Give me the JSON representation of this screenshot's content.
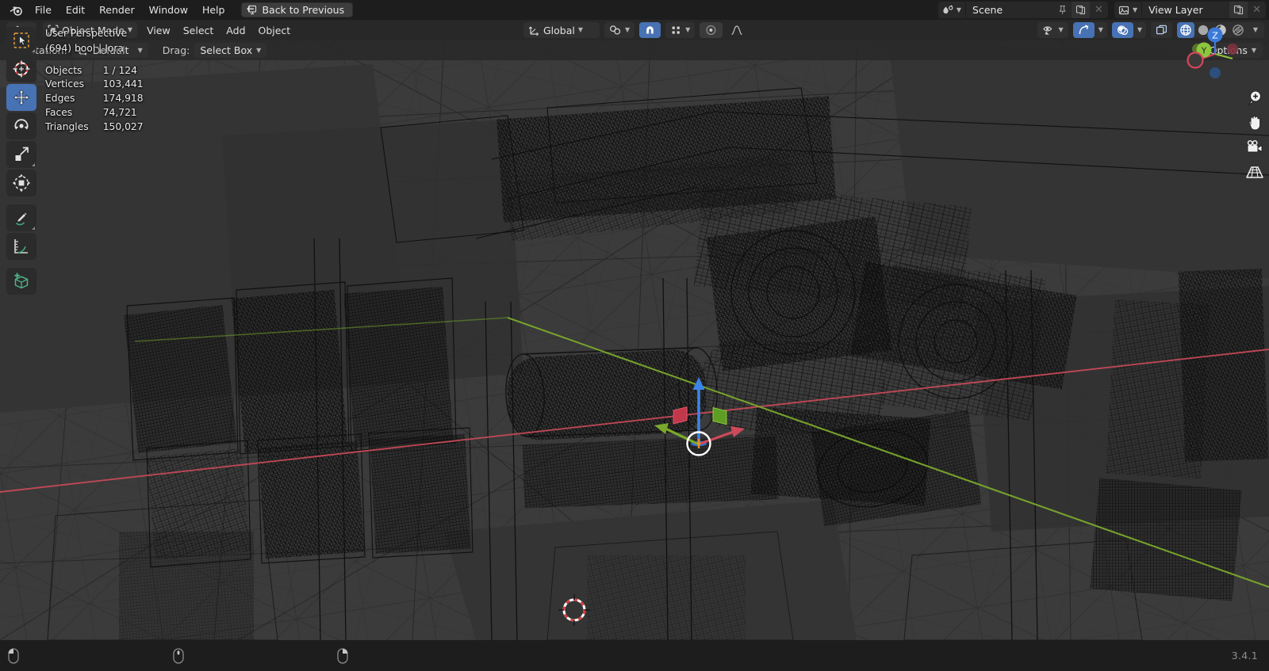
{
  "app": {
    "name": "Blender",
    "version": "3.4.1"
  },
  "topbar": {
    "logo_icon": "blender-logo-icon",
    "menus": [
      {
        "label": "File",
        "name": "menu-file"
      },
      {
        "label": "Edit",
        "name": "menu-edit"
      },
      {
        "label": "Render",
        "name": "menu-render"
      },
      {
        "label": "Window",
        "name": "menu-window"
      },
      {
        "label": "Help",
        "name": "menu-help"
      }
    ],
    "back_to_previous": {
      "label": "Back to Previous",
      "icon": "back-to-previous-icon"
    },
    "scene": {
      "icon": "scene-data-icon",
      "value": "Scene",
      "pin_icon": "pin-icon",
      "copy_icon": "new-scene-icon",
      "close_icon": "unlink-icon"
    },
    "view_layer": {
      "icon": "view-layer-icon",
      "value": "View Layer",
      "copy_icon": "new-view-layer-icon",
      "close_icon": "remove-view-layer-icon"
    }
  },
  "viewport_header": {
    "editor_type_icon": "editor-type-3d-viewport-icon",
    "mode": {
      "icon": "object-mode-icon",
      "label": "Object Mode"
    },
    "menus": [
      {
        "label": "View",
        "name": "viewport-menu-view"
      },
      {
        "label": "Select",
        "name": "viewport-menu-select"
      },
      {
        "label": "Add",
        "name": "viewport-menu-add"
      },
      {
        "label": "Object",
        "name": "viewport-menu-object"
      }
    ],
    "transform_orientation": {
      "icon": "transform-orientation-icon",
      "value": "Global"
    },
    "snap_target": {
      "icon": "snap-target-icon"
    },
    "snap_magnet": {
      "icon": "magnet-icon",
      "enabled": true
    },
    "snap_element": {
      "icon": "snap-increment-icon"
    },
    "proportional_editing": {
      "icon": "proportional-editing-icon",
      "enabled": false
    },
    "falloff": {
      "icon": "falloff-smooth-icon"
    },
    "visibility": {
      "icon": "object-visibility-icon"
    },
    "gizmo": {
      "icon": "gizmo-icon",
      "enabled": true
    },
    "overlays": {
      "icon": "overlays-icon",
      "enabled": true
    },
    "xray": {
      "icon": "xray-toggle-icon",
      "enabled": false
    },
    "shading_modes": [
      {
        "name": "shading-wireframe",
        "icon": "wireframe-shading-icon",
        "active": true
      },
      {
        "name": "shading-solid",
        "icon": "solid-shading-icon",
        "active": false
      },
      {
        "name": "shading-material-preview",
        "icon": "material-preview-icon",
        "active": false
      },
      {
        "name": "shading-rendered",
        "icon": "rendered-shading-icon",
        "active": false
      }
    ]
  },
  "tool_settings": {
    "orientation_label": "Orientation:",
    "orientation_icon": "orientation-default-icon",
    "orientation_value": "Default",
    "drag_label": "Drag:",
    "drag_value": "Select Box",
    "options_label": "Options"
  },
  "toolbar": [
    {
      "name": "tool-select-box",
      "icon": "select-box-icon",
      "active": false
    },
    {
      "name": "tool-cursor",
      "icon": "cursor-3d-icon",
      "active": false
    },
    {
      "name": "tool-move",
      "icon": "move-icon",
      "active": true
    },
    {
      "name": "tool-rotate",
      "icon": "rotate-icon",
      "active": false
    },
    {
      "name": "tool-scale",
      "icon": "scale-icon",
      "active": false
    },
    {
      "name": "tool-transform",
      "icon": "transform-icon",
      "active": false
    },
    {
      "name": "tool-annotate",
      "icon": "annotate-icon",
      "active": false
    },
    {
      "name": "tool-measure",
      "icon": "measure-icon",
      "active": false
    },
    {
      "name": "tool-add-cube",
      "icon": "add-cube-icon",
      "active": false
    }
  ],
  "statistics": {
    "perspective": "User Perspective",
    "active_object": "(694) bool | Jora",
    "rows": [
      {
        "key": "Objects",
        "value": "1 / 124"
      },
      {
        "key": "Vertices",
        "value": "103,441"
      },
      {
        "key": "Edges",
        "value": "174,918"
      },
      {
        "key": "Faces",
        "value": "74,721"
      },
      {
        "key": "Triangles",
        "value": "150,027"
      }
    ]
  },
  "nav_gizmo": {
    "axes": [
      {
        "label": "Z",
        "name": "gizmo-axis-z-positive",
        "color": "#3b7ad9"
      },
      {
        "label": "Y",
        "name": "gizmo-axis-y-positive",
        "color": "#8cc63e"
      },
      {
        "label": "X",
        "name": "gizmo-axis-x-positive",
        "color": "#d8455a"
      }
    ],
    "negative_axes": [
      {
        "name": "gizmo-axis-x-negative",
        "color": "#d8455a"
      },
      {
        "name": "gizmo-axis-y-negative",
        "color": "#8cc63e"
      },
      {
        "name": "gizmo-axis-z-negative",
        "color": "#3b7ad9"
      }
    ]
  },
  "nav_icons": [
    {
      "name": "zoom-view-icon",
      "icon": "zoom-icon"
    },
    {
      "name": "pan-view-icon",
      "icon": "hand-icon"
    },
    {
      "name": "camera-view-icon",
      "icon": "camera-icon"
    },
    {
      "name": "toggle-perspective-icon",
      "icon": "grid-perspective-icon"
    }
  ],
  "statusbar": {
    "hints": [
      {
        "name": "status-hint-left-mouse",
        "icon": "mouse-left-icon"
      },
      {
        "name": "status-hint-middle-mouse",
        "icon": "mouse-middle-icon"
      },
      {
        "name": "status-hint-right-mouse",
        "icon": "mouse-right-icon"
      }
    ],
    "version": "3.4.1"
  },
  "colors": {
    "accent_blue": "#4772b3",
    "viewport_bg": "#3b3b3b",
    "axis_x_red": "#cd4a5a",
    "axis_y_green": "#7aa82c",
    "gizmo_z_blue": "#3b85e8",
    "panel_bg": "#282828",
    "topbar_bg": "#1d1d1d"
  }
}
